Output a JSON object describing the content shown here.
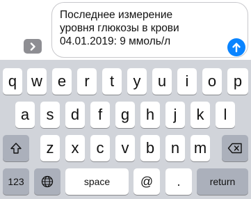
{
  "compose": {
    "message_text": "Последнее измерение\nуровня глюкозы в крови\n04.01.2019: 9 ммоль/л",
    "expand_icon": "chevron-right-icon",
    "send_icon": "arrow-up-icon",
    "send_color": "#0a84ff"
  },
  "keyboard": {
    "row1": [
      "q",
      "w",
      "e",
      "r",
      "t",
      "y",
      "u",
      "i",
      "o",
      "p"
    ],
    "row2": [
      "a",
      "s",
      "d",
      "f",
      "g",
      "h",
      "j",
      "k",
      "l"
    ],
    "row3": [
      "z",
      "x",
      "c",
      "v",
      "b",
      "n",
      "m"
    ],
    "bottom": {
      "numbers_label": "123",
      "space_label": "space",
      "at_label": "@",
      "dot_label": ".",
      "return_label": "return"
    },
    "icons": {
      "shift": "shift-icon",
      "delete": "delete-icon",
      "globe": "globe-icon"
    }
  }
}
